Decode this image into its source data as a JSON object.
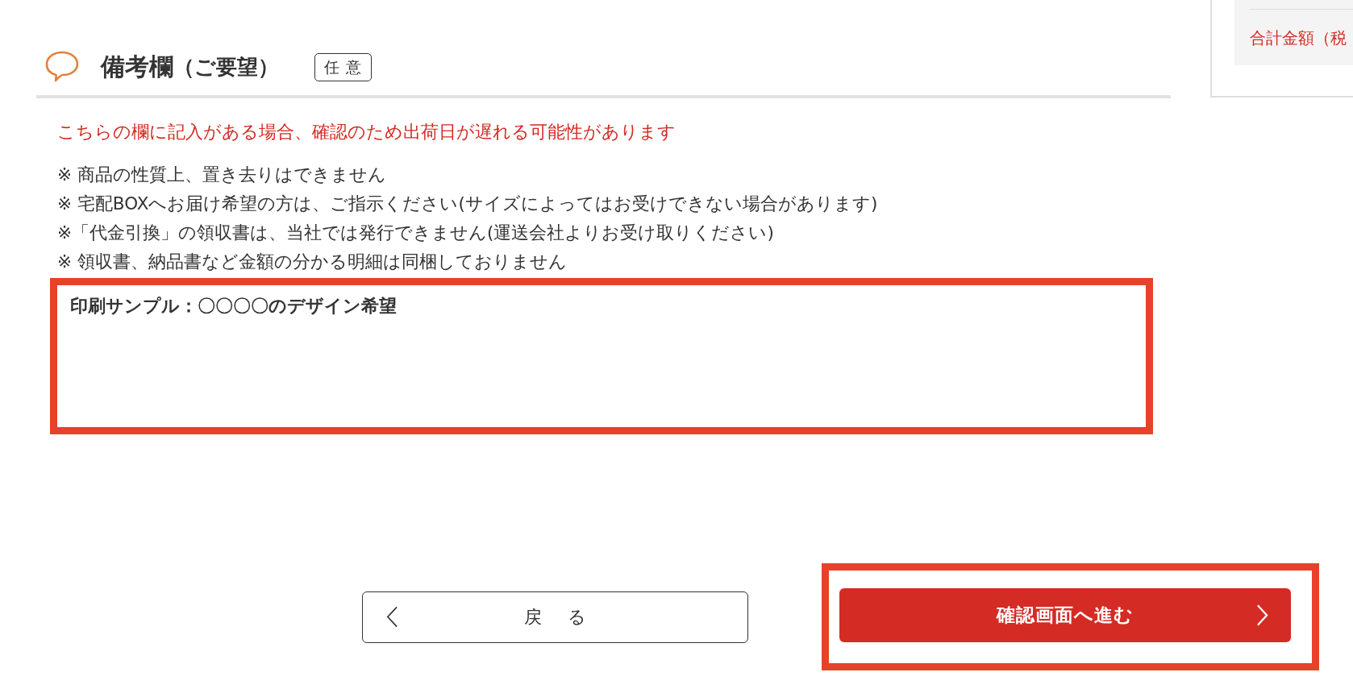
{
  "summary_panel": {
    "label": "合計金額（税"
  },
  "remarks_section": {
    "title": "備考欄",
    "title_note": "（ご要望）",
    "badge": "任意",
    "warning": "こちらの欄に記入がある場合、確認のため出荷日が遅れる可能性があります",
    "notes": [
      "※ 商品の性質上、置き去りはできません",
      "※ 宅配BOXへお届け希望の方は、ご指示ください(サイズによってはお受けできない場合があります)",
      "※「代金引換」の領収書は、当社では発行できません(運送会社よりお受け取りください)",
      "※ 領収書、納品書など金額の分かる明細は同梱しておりません"
    ],
    "field": {
      "value": "印刷サンプル：〇〇〇〇のデザイン希望",
      "highlighted": true
    }
  },
  "buttons": [
    {
      "kind": "back",
      "label": "戻る",
      "highlighted": false
    },
    {
      "kind": "next",
      "label": "確認画面へ進む",
      "highlighted": true
    }
  ]
}
